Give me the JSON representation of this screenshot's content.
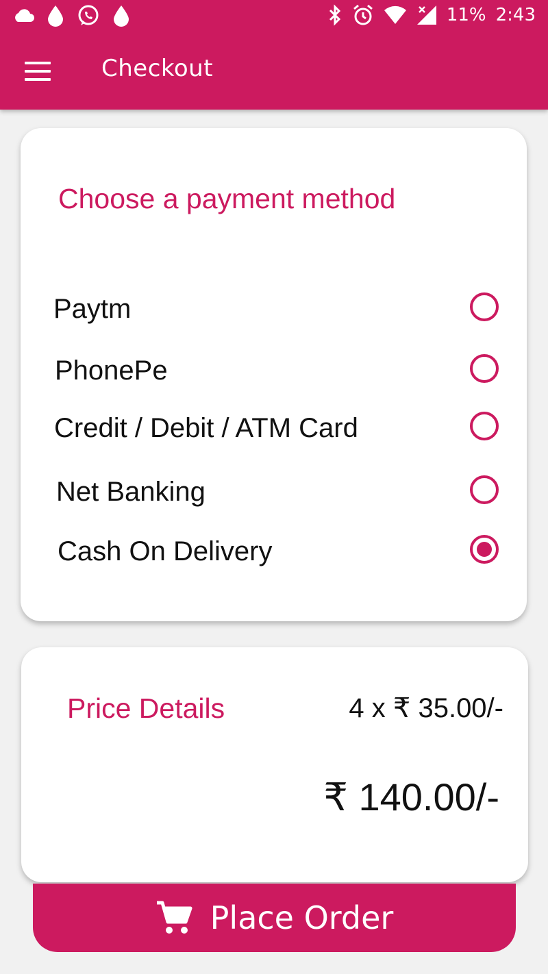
{
  "status_bar": {
    "icons_left": [
      "cloud-icon",
      "drop-icon",
      "whatsapp-icon",
      "drop-icon"
    ],
    "icons_right": [
      "bluetooth-icon",
      "alarm-icon",
      "wifi-icon",
      "signal-icon"
    ],
    "battery": "11%",
    "time": "2:43"
  },
  "toolbar": {
    "title": "Checkout",
    "menu_icon": "menu-icon"
  },
  "payment": {
    "heading": "Choose a payment method",
    "options": [
      {
        "label": "Paytm",
        "selected": false
      },
      {
        "label": "PhonePe",
        "selected": false
      },
      {
        "label": "Credit / Debit / ATM Card",
        "selected": false
      },
      {
        "label": "Net Banking",
        "selected": false
      },
      {
        "label": "Cash On Delivery",
        "selected": true
      }
    ]
  },
  "price": {
    "heading": "Price Details",
    "unit_price": "4 x ₹ 35.00/-",
    "total": "₹ 140.00/-"
  },
  "place_order": {
    "label": "Place Order",
    "icon": "cart-icon"
  },
  "colors": {
    "accent": "#cc1a5f",
    "background": "#f1f1f1",
    "card": "#ffffff"
  }
}
